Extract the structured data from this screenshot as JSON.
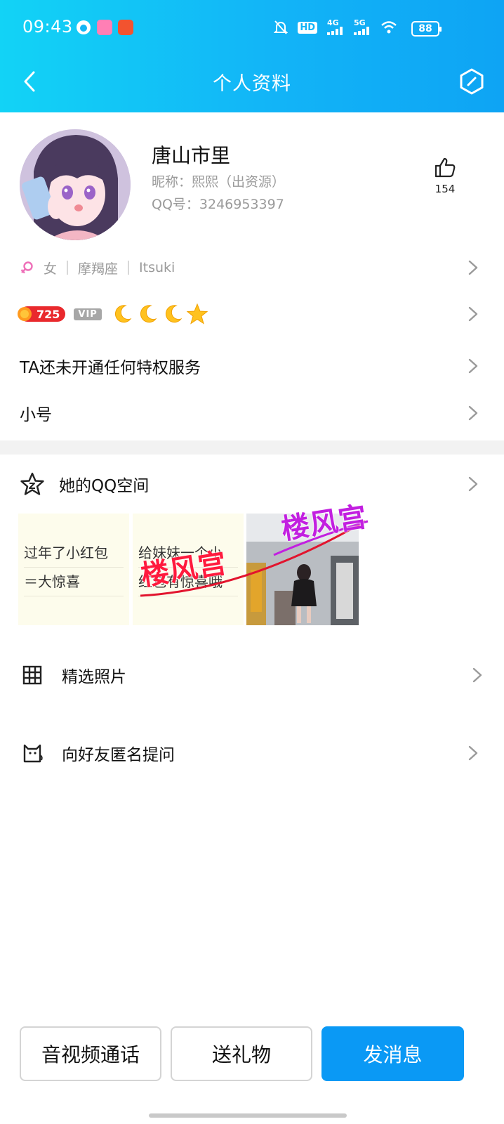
{
  "status_bar": {
    "time": "09:43",
    "battery": "88",
    "network": [
      "4G",
      "5G"
    ],
    "hd_label": "HD"
  },
  "header": {
    "title": "个人资料"
  },
  "profile": {
    "name": "唐山市里",
    "nickname": "昵称：熙熙（出资源）",
    "qq_number": "QQ号：3246953397",
    "likes": "154"
  },
  "basic_info": {
    "gender": "女",
    "zodiac": "摩羯座",
    "extra": "Itsuki"
  },
  "level": {
    "value": "725",
    "vip": "VIP"
  },
  "privilege_row": "TA还未开通任何特权服务",
  "alt_account_row": "小号",
  "qzone": {
    "title": "她的QQ空间",
    "posts": [
      {
        "line1": "过年了小红包",
        "line2": "＝大惊喜"
      },
      {
        "line1": "给妹妹一个小",
        "line2": "红包有惊喜哦"
      }
    ],
    "watermark": "楼风宫"
  },
  "photos_row": "精选照片",
  "anon_question_row": "向好友匿名提问",
  "buttons": {
    "call": "音视频通话",
    "gift": "送礼物",
    "message": "发消息"
  },
  "colors": {
    "header_start": "#12d3f6",
    "header_end": "#0ea4f4",
    "primary": "#0a99f5",
    "level_red": "#e9292d",
    "watermark_red": "#ff1a3d",
    "watermark_magenta": "#c21fe0"
  }
}
